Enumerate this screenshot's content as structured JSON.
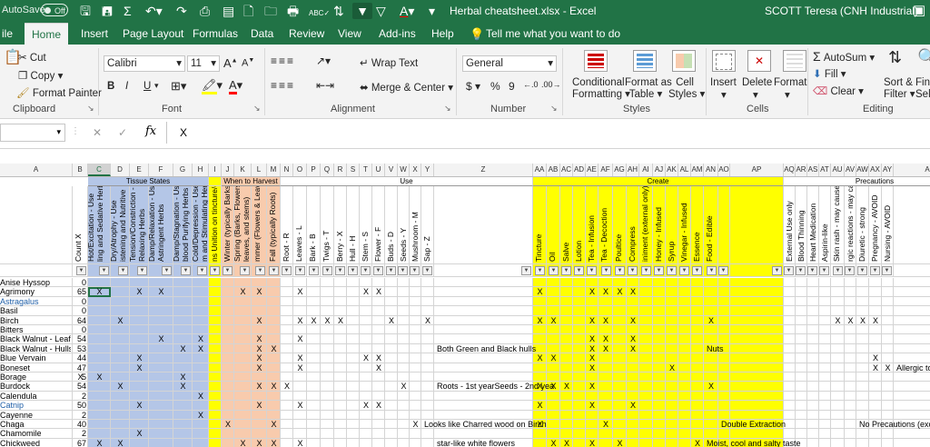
{
  "titlebar": {
    "autosave_label": "AutoSave",
    "autosave_state": "Off",
    "doc_title": "Herbal cheatsheet.xlsx  -  Excel",
    "user": "SCOTT Teresa (CNH Industrial)"
  },
  "tabs": [
    "ile",
    "Home",
    "Insert",
    "Page Layout",
    "Formulas",
    "Data",
    "Review",
    "View",
    "Add-ins",
    "Help",
    "Tell me what you want to do"
  ],
  "active_tab": "Home",
  "ribbon": {
    "cut": "Cut",
    "copy": "Copy",
    "format_painter": "Format Painter",
    "clipboard": "Clipboard",
    "font_name": "Calibri",
    "font_size": "11",
    "font_group": "Font",
    "bold": "B",
    "italic": "I",
    "underline": "U",
    "wrap_text": "Wrap Text",
    "merge_center": "Merge & Center",
    "alignment": "Alignment",
    "number_format": "General",
    "number_group": "Number",
    "currency": "$",
    "percent": "%",
    "comma": "9",
    "cond_format": [
      "Conditional",
      "Formatting"
    ],
    "format_table": [
      "Format as",
      "Table"
    ],
    "cell_styles": [
      "Cell",
      "Styles"
    ],
    "styles_group": "Styles",
    "insert": "Insert",
    "delete": "Delete",
    "format": "Format",
    "cells_group": "Cells",
    "autosum": "AutoSum",
    "fill": "Fill",
    "clear": "Clear",
    "sort_filter": [
      "Sort &",
      "Filter"
    ],
    "find_select": [
      "Fin",
      "Sel"
    ],
    "editing_group": "Editing"
  },
  "formula_bar": {
    "fx": "fx",
    "value": "X"
  },
  "columns": [
    "A",
    "B",
    "C",
    "D",
    "E",
    "F",
    "G",
    "H",
    "I",
    "J",
    "K",
    "L",
    "M",
    "N",
    "O",
    "P",
    "Q",
    "R",
    "S",
    "T",
    "U",
    "V",
    "W",
    "X",
    "Y",
    "Z",
    "AA",
    "AB",
    "AC",
    "AD",
    "AE",
    "AF",
    "AG",
    "AH",
    "AI",
    "AJ",
    "AK",
    "AL",
    "AM",
    "AN",
    "AO",
    "AP",
    "AQ",
    "AR",
    "AS",
    "AT",
    "AU",
    "AV",
    "AW",
    "AX",
    "AY",
    "AZ"
  ],
  "selected_column": "C",
  "groups": {
    "tissue_states": "Tissue States",
    "when_to_harvest": "When to Harvest",
    "use": "Use",
    "create": "Create",
    "precautions": "Precautions"
  },
  "headers": {
    "B": "Count X",
    "C": "Hot/Excitation - Use",
    "C2": "ling and Sedative Herbs",
    "D": "Dry/Atrophy - Use",
    "D2": "istening and Nutritive",
    "E": "Tension/Constriction - Use",
    "E2": "Relaxing Herbs",
    "F": "Damp/Relaxation - Use",
    "F2": "Astringent Herbs",
    "G": "Damp/Stagnation - Use",
    "G2": "blood Purifying Herbs",
    "H": "Cold/Depression - Use",
    "H2": "m and Stimulating Herbs",
    "I": "ns Unition on tincture/oil",
    "J": "Winter (typically Barks)",
    "K": "Spring (Barks, Flowers,",
    "K2": "leaves, and stems)",
    "L": "mmer (Flowers & Leaves",
    "M": "Fall (typically Roots)",
    "N": "Root - R",
    "O": "Leaves - L",
    "P": "Bark - B",
    "Q": "Twigs - T",
    "R": "Berry - X",
    "S": "Hull - H",
    "T": "Stem - S",
    "U": "Flower - F",
    "V": "Buds - D",
    "W": "Seeds - Y",
    "X": "Mushroom - M",
    "Y": "Sap - Z",
    "AA": "Tincture",
    "AB": "Oil",
    "AC": "Salve",
    "AD": "Lotion",
    "AE": "Tea - Infusion",
    "AF": "Tea - Decoction",
    "AG": "Poultice",
    "AH": "Compress",
    "AI": "iniment (external only)",
    "AJ": "Honey - Infused",
    "AK": "Syrup",
    "AL": "Vinegar - Infused",
    "AM": "Essence",
    "AN": "Food - Edible",
    "AQ": "External Use only",
    "AR": "Blood Thinning",
    "AS": "Heart Medication",
    "AT": "Aspirin-like",
    "AU": "Skin rash - may cause",
    "AV": "rgic reactions - may cau",
    "AW": "Diuretic - strong",
    "AX": "Pregnancy - AVOID",
    "AY": "Nursing - AVOID"
  },
  "rows": [
    {
      "name": "Anise Hyssop",
      "count": "0",
      "link": false,
      "marks": []
    },
    {
      "name": "Agrimony",
      "count": "65",
      "link": false,
      "marks": [
        "C",
        "E",
        "F",
        "K",
        "L",
        "O",
        "T",
        "U",
        "AA",
        "AE",
        "AF",
        "AG",
        "AH"
      ]
    },
    {
      "name": "Astragalus",
      "count": "0",
      "link": true,
      "marks": []
    },
    {
      "name": "Basil",
      "count": "0",
      "link": false,
      "marks": []
    },
    {
      "name": "Birch",
      "count": "64",
      "link": false,
      "marks": [
        "D",
        "L",
        "O",
        "P",
        "Q",
        "R",
        "V",
        "Y",
        "AA",
        "AB",
        "AE",
        "AF",
        "AH",
        "AN",
        "AU",
        "AV",
        "AW",
        "AX"
      ]
    },
    {
      "name": "Bitters",
      "count": "0",
      "link": false,
      "marks": []
    },
    {
      "name": "Black Walnut - Leaf",
      "count": "54",
      "link": false,
      "marks": [
        "F",
        "H",
        "L",
        "O",
        "AE",
        "AF",
        "AH"
      ]
    },
    {
      "name": "Black Walnut - Hulls",
      "count": "53",
      "link": false,
      "marks": [
        "G",
        "H",
        "L",
        "M",
        "AE",
        "AF",
        "AH"
      ],
      "notes": [
        {
          "col": "Z",
          "text": "Both Green and Black hulls"
        },
        {
          "col": "AN",
          "text": "Nuts"
        }
      ]
    },
    {
      "name": "Blue Vervain",
      "count": "44",
      "link": false,
      "marks": [
        "E",
        "L",
        "O",
        "T",
        "U",
        "AA",
        "AB",
        "AE",
        "AX"
      ]
    },
    {
      "name": "Boneset",
      "count": "47",
      "link": false,
      "marks": [
        "E",
        "L",
        "O",
        "U",
        "AE",
        "AK",
        "AX",
        "AY"
      ],
      "notes": [
        {
          "col": "AZ",
          "text": "Allergic to D"
        }
      ]
    },
    {
      "name": "Borage",
      "count": "5",
      "link": false,
      "marks": [
        "B",
        "C",
        "G"
      ]
    },
    {
      "name": "Burdock",
      "count": "54",
      "link": false,
      "marks": [
        "D",
        "G",
        "L",
        "M",
        "N",
        "W",
        "AA",
        "AB",
        "AC",
        "AE",
        "AN"
      ],
      "notes": [
        {
          "col": "Z",
          "text": "Roots - 1st yearSeeds - 2nd yea"
        }
      ]
    },
    {
      "name": "Calendula",
      "count": "2",
      "link": false,
      "marks": [
        "H"
      ]
    },
    {
      "name": "Catnip",
      "count": "50",
      "link": true,
      "marks": [
        "E",
        "L",
        "O",
        "T",
        "U",
        "AA",
        "AE",
        "AH"
      ]
    },
    {
      "name": "Cayenne",
      "count": "2",
      "link": false,
      "marks": [
        "H"
      ]
    },
    {
      "name": "Chaga",
      "count": "40",
      "link": false,
      "marks": [
        "J",
        "M",
        "X",
        "AA",
        "AF"
      ],
      "notes": [
        {
          "col": "Y",
          "text": "Looks like Charred wood on Birch"
        },
        {
          "col": "AO",
          "text": "Double Extraction"
        },
        {
          "col": "AW",
          "text": "No Precautions (exc"
        }
      ]
    },
    {
      "name": "Chamomile",
      "count": "2",
      "link": false,
      "marks": [
        "E"
      ]
    },
    {
      "name": "Chickweed",
      "count": "67",
      "link": false,
      "marks": [
        "C",
        "D",
        "K",
        "L",
        "M",
        "O",
        "AB",
        "AC",
        "AE",
        "AG",
        "AM"
      ],
      "notes": [
        {
          "col": "Z",
          "text": "star-like white flowers"
        },
        {
          "col": "AN",
          "text": "Moist, cool and salty taste"
        }
      ]
    }
  ]
}
